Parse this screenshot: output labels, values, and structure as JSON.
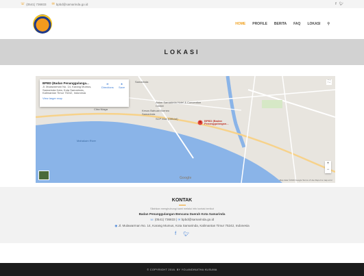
{
  "topbar": {
    "phone": "(0541) 736833",
    "email": "bpbd@samarinda.go.id",
    "social": [
      "f",
      "twitter-icon"
    ]
  },
  "nav": {
    "items": [
      "HOME",
      "PROFILE",
      "BERITA",
      "FAQ",
      "LOKASI"
    ],
    "active": "HOME"
  },
  "banner": {
    "title": "LOKASI"
  },
  "map": {
    "info_title": "BPBD (Badan Penanggulanga...",
    "info_address": "Jl. Mulawarman No. 14, Karang Mumus, Samarinda Kota, Kota Samarinda, Kalimantan Timur 75242, Indonesia",
    "info_link": "View larger map",
    "directions": "Directions",
    "save": "Save",
    "labels": {
      "samarinda": "Samarinda",
      "aston": "Aston Samarinda Hotel & Convention Center",
      "citra": "Citra Niaga",
      "kesos": "Kesos Bahuan Borneo Samarinda",
      "scp": "SCP Mall (Official)",
      "pin": "BPBD (Badan Penanggulangan...",
      "mahakam": "Mahakam River"
    },
    "google": "Google",
    "footer": "Map data ©2019 Google   Terms of Use   Report a map error"
  },
  "contact": {
    "title": "KONTAK",
    "subtitle": "Silahkan menghubungi kami melalui info kontak berikut",
    "org": "Badan Penanggulangan Bencana Daerah Kota Samarinda",
    "phone": "(0541) 736833",
    "email": "bpbd@samarinda.go.id",
    "address": "Jl. Mulawarman No. 14, Karang Mumus, Kota Samarinda, Kalimantan Timur 75242, Indonesia"
  },
  "footer": {
    "copyright": "© COPYRIGHT 2016. BY YOLANDINATHA KUSUMA"
  }
}
